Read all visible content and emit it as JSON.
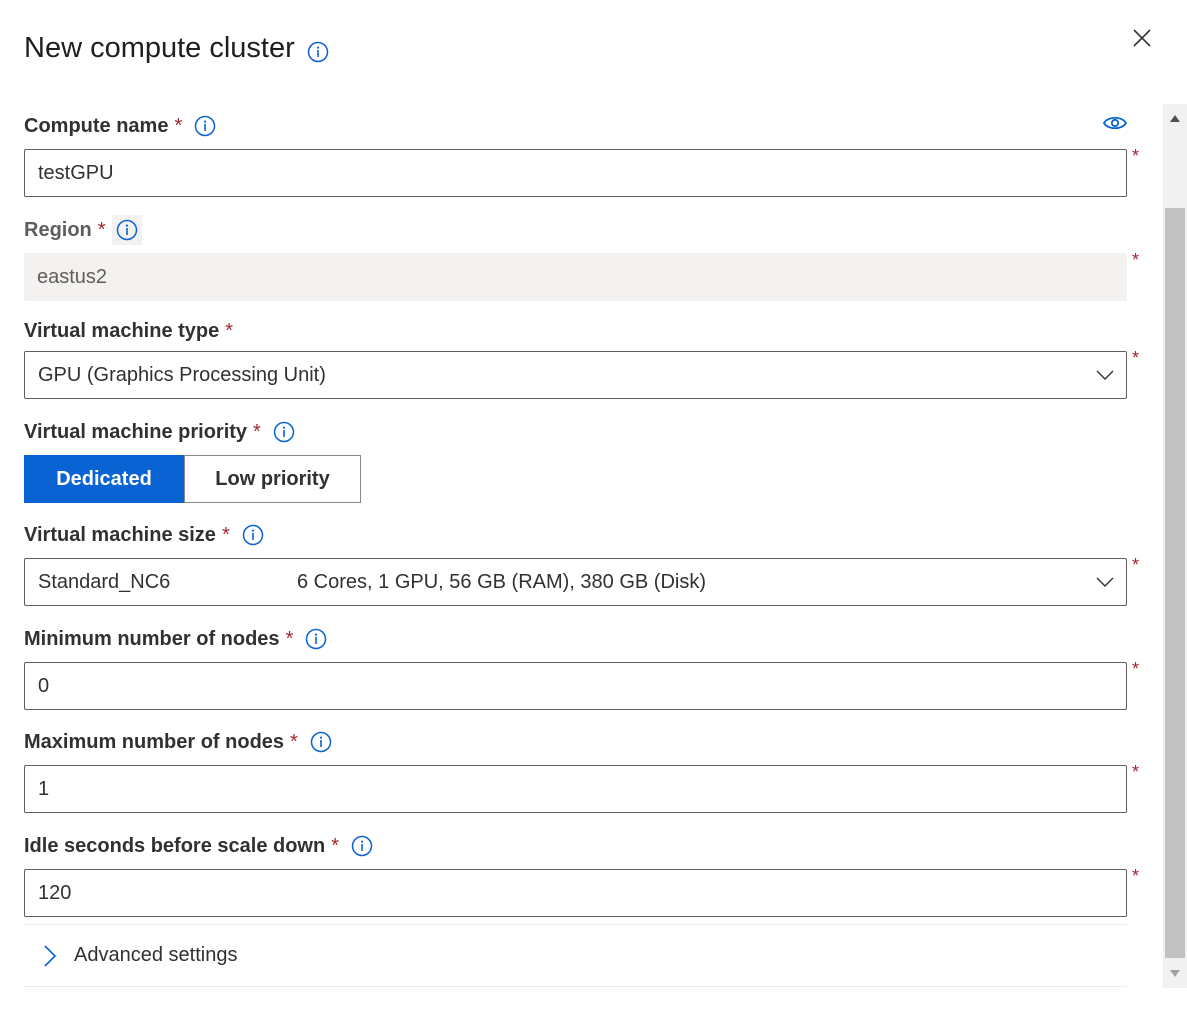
{
  "dialog": {
    "title": "New compute cluster"
  },
  "required_marker": "*",
  "compute_name": {
    "label": "Compute name",
    "value": "testGPU"
  },
  "region": {
    "label": "Region",
    "value": "eastus2"
  },
  "vm_type": {
    "label": "Virtual machine type",
    "value": "GPU (Graphics Processing Unit)"
  },
  "vm_priority": {
    "label": "Virtual machine priority",
    "options": [
      "Dedicated",
      "Low priority"
    ],
    "selected": "Dedicated"
  },
  "vm_size": {
    "label": "Virtual machine size",
    "name": "Standard_NC6",
    "specs": "6 Cores, 1 GPU, 56 GB (RAM), 380 GB (Disk)"
  },
  "min_nodes": {
    "label": "Minimum number of nodes",
    "value": "0"
  },
  "max_nodes": {
    "label": "Maximum number of nodes",
    "value": "1"
  },
  "idle_seconds": {
    "label": "Idle seconds before scale down",
    "value": "120"
  },
  "advanced": {
    "label": "Advanced settings"
  },
  "colors": {
    "accent": "#0a63d3",
    "required": "#a4262c",
    "text": "#323130",
    "disabled_bg": "#f3f2f1"
  },
  "icons": {
    "info": "info-circle-icon",
    "close": "close-icon",
    "show_password": "eye-icon",
    "dropdown": "chevron-down-icon",
    "expand": "chevron-right-icon"
  }
}
